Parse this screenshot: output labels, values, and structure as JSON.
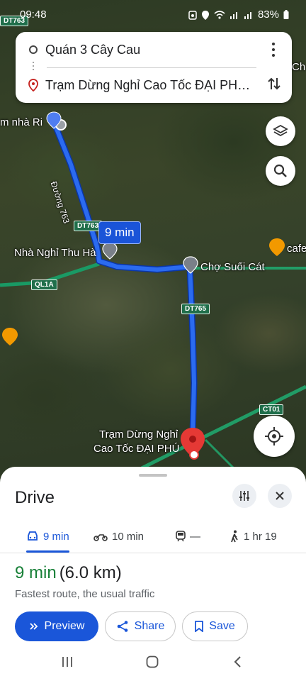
{
  "status_bar": {
    "time": "09:48",
    "battery": "83%"
  },
  "route_card": {
    "origin": "Quán 3 Cây Cau",
    "destination": "Trạm Dừng Nghỉ Cao Tốc ĐẠI PHÚ,..."
  },
  "map": {
    "labels": {
      "nha_ri": "m nhà Ri",
      "duong_763": "Đường 763",
      "nha_nghi": "Nhà Nghỉ Thu Hà",
      "cho_suoi_cat": "Chợ Suối Cát",
      "cafe": "cafe",
      "dest_line1": "Trạm Dừng Nghỉ",
      "dest_line2": "Cao Tốc ĐẠI PHÚ",
      "edge_ch": "Ch"
    },
    "shields": {
      "dt763_top": "DT763",
      "dt763_mid": "DT763",
      "ql1a": "QL1A",
      "dt765": "DT765",
      "ct01": "CT01"
    },
    "route_time": "9 min"
  },
  "sheet": {
    "title": "Drive",
    "tabs": [
      {
        "label": "9 min",
        "icon": "car-icon"
      },
      {
        "label": "10 min",
        "icon": "motorbike-icon"
      },
      {
        "label": "—",
        "icon": "train-icon"
      },
      {
        "label": "1 hr 19",
        "icon": "walk-icon"
      }
    ],
    "duration": "9 min",
    "distance": "(6.0 km)",
    "subtitle": "Fastest route, the usual traffic",
    "buttons": {
      "preview": "Preview",
      "share": "Share",
      "save": "Save"
    }
  },
  "colors": {
    "route": "#1a56d9",
    "duration": "#188038",
    "pin": "#e53935"
  }
}
